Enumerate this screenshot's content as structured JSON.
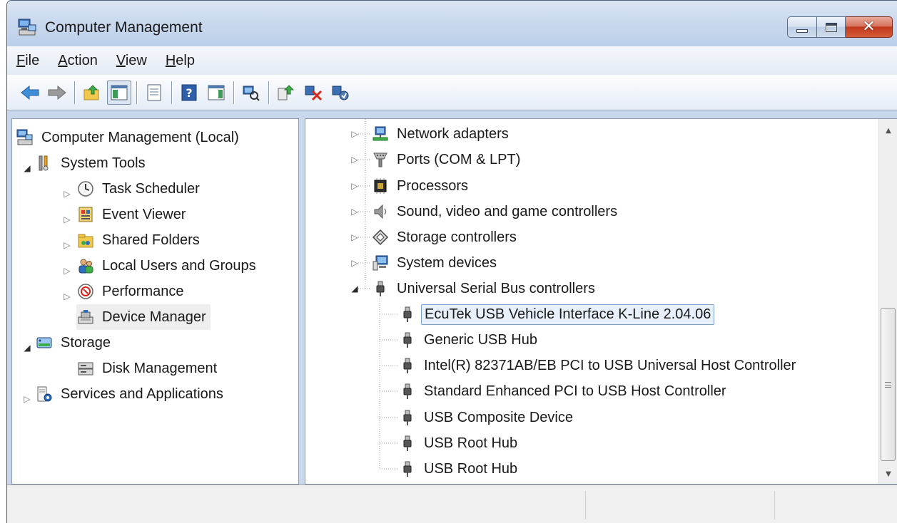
{
  "window": {
    "title": "Computer Management"
  },
  "menu": [
    {
      "label": "File",
      "accel": "F",
      "rest": "ile"
    },
    {
      "label": "Action",
      "accel": "A",
      "rest": "ction"
    },
    {
      "label": "View",
      "accel": "V",
      "rest": "iew"
    },
    {
      "label": "Help",
      "accel": "H",
      "rest": "elp"
    }
  ],
  "toolbar": {
    "buttons": [
      "back-icon",
      "forward-icon",
      "up-folder-icon",
      "show-hide-console-tree-icon",
      "properties-icon",
      "help-icon",
      "show-action-pane-icon",
      "scan-hardware-icon",
      "update-driver-icon",
      "uninstall-icon",
      "enable-device-icon"
    ]
  },
  "left_tree": {
    "root": "Computer Management (Local)",
    "system_tools": "System Tools",
    "task_scheduler": "Task Scheduler",
    "event_viewer": "Event Viewer",
    "shared_folders": "Shared Folders",
    "local_users": "Local Users and Groups",
    "performance": "Performance",
    "device_manager": "Device Manager",
    "storage": "Storage",
    "disk_management": "Disk Management",
    "services_apps": "Services and Applications"
  },
  "device_tree": {
    "categories": {
      "network": "Network adapters",
      "ports": "Ports (COM & LPT)",
      "processors": "Processors",
      "sound": "Sound, video and game controllers",
      "storage": "Storage controllers",
      "system": "System devices",
      "usb": "Universal Serial Bus controllers"
    },
    "usb_devices": [
      "EcuTek USB Vehicle Interface K-Line 2.04.06",
      "Generic USB Hub",
      "Intel(R) 82371AB/EB PCI to USB Universal Host Controller",
      "Standard Enhanced PCI to USB Host Controller",
      "USB Composite Device",
      "USB Root Hub",
      "USB Root Hub"
    ]
  },
  "colors": {
    "title_bg": "#c9d7ea",
    "selection_border": "#7da2ce",
    "selection_bg": "#e8f1fb",
    "close_button": "#c2391d"
  }
}
